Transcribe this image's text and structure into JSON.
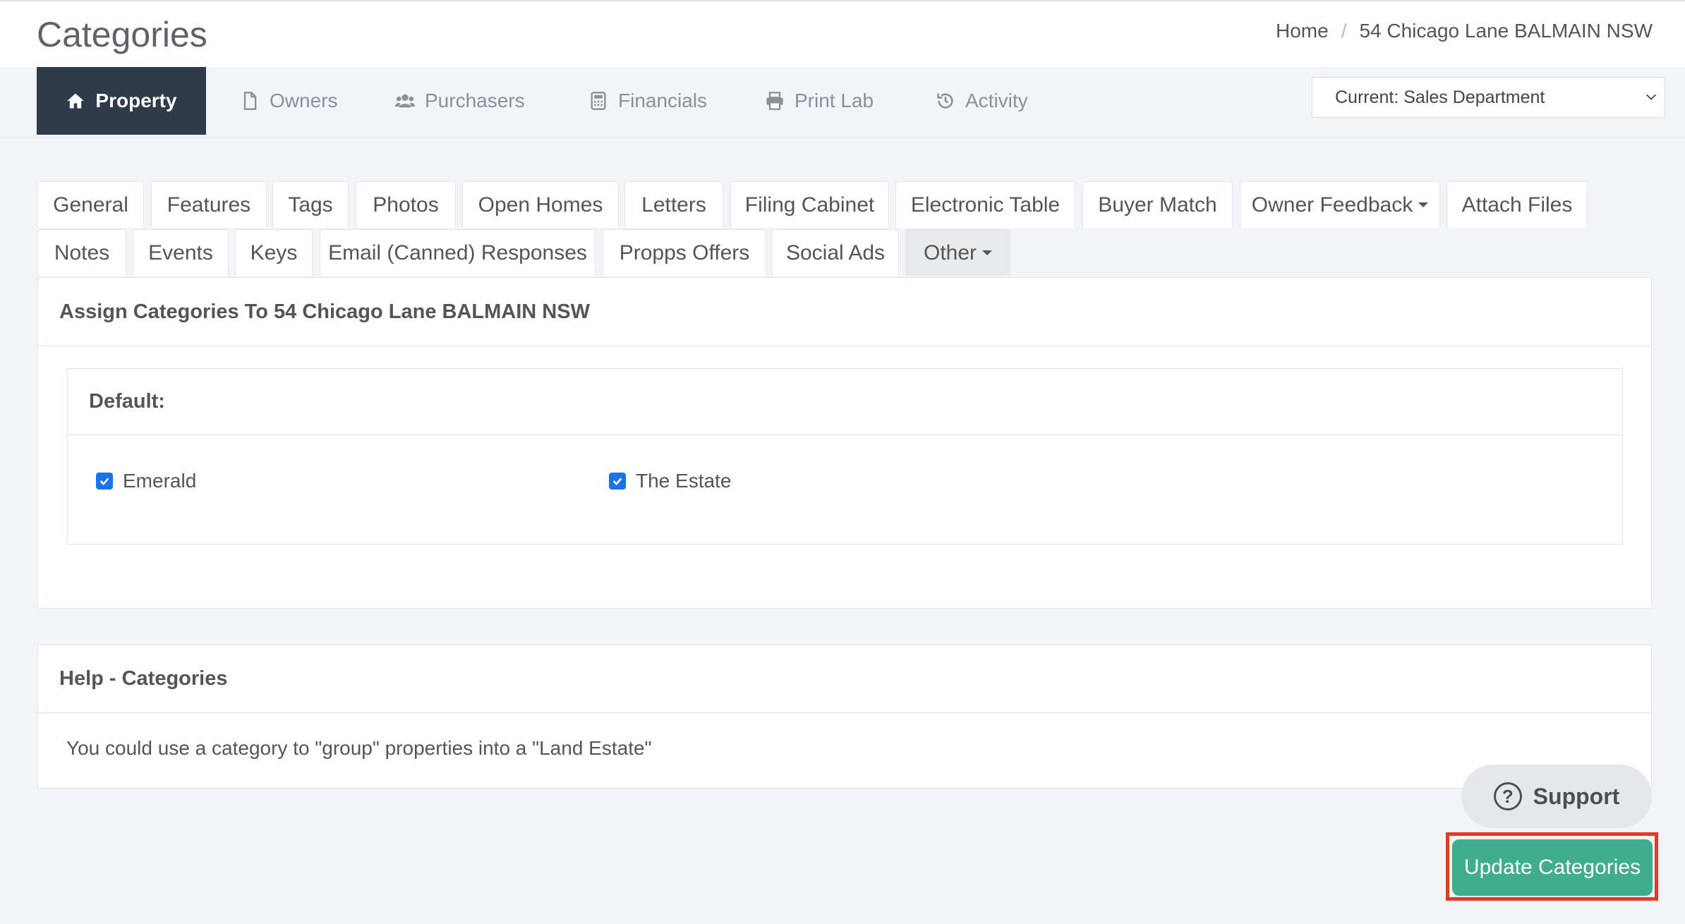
{
  "header": {
    "title": "Categories",
    "breadcrumb": [
      "Home",
      "54 Chicago Lane BALMAIN NSW"
    ],
    "breadcrumb_sep": "/"
  },
  "nav": {
    "tabs": [
      {
        "label": "Property",
        "icon": "home-icon"
      },
      {
        "label": "Owners",
        "icon": "file-icon"
      },
      {
        "label": "Purchasers",
        "icon": "users-icon"
      },
      {
        "label": "Financials",
        "icon": "calculator-icon"
      },
      {
        "label": "Print Lab",
        "icon": "printer-icon"
      },
      {
        "label": "Activity",
        "icon": "history-icon"
      }
    ],
    "department": "Current: Sales Department"
  },
  "subtabs": {
    "row1": [
      "General",
      "Features",
      "Tags",
      "Photos",
      "Open Homes",
      "Letters",
      "Filing Cabinet",
      "Electronic Table",
      "Buyer Match",
      "Owner Feedback",
      "Attach Files"
    ],
    "row2": [
      "Notes",
      "Events",
      "Keys",
      "Email (Canned) Responses",
      "Propps Offers",
      "Social Ads",
      "Other"
    ]
  },
  "assign_panel": {
    "heading": "Assign Categories To 54 Chicago Lane BALMAIN NSW",
    "group": {
      "label": "Default:",
      "items": [
        {
          "label": "Emerald",
          "checked": true
        },
        {
          "label": "The Estate",
          "checked": true
        }
      ]
    }
  },
  "help_panel": {
    "heading": "Help - Categories",
    "text": "You could use a category to \"group\" properties into a \"Land Estate\""
  },
  "support": {
    "label": "Support"
  },
  "actions": {
    "update_label": "Update Categories"
  },
  "colors": {
    "nav_active": "#2f3a4b",
    "update_button": "#3fae8c",
    "checkbox": "#1a73e8",
    "highlight_border": "#e23a24"
  }
}
